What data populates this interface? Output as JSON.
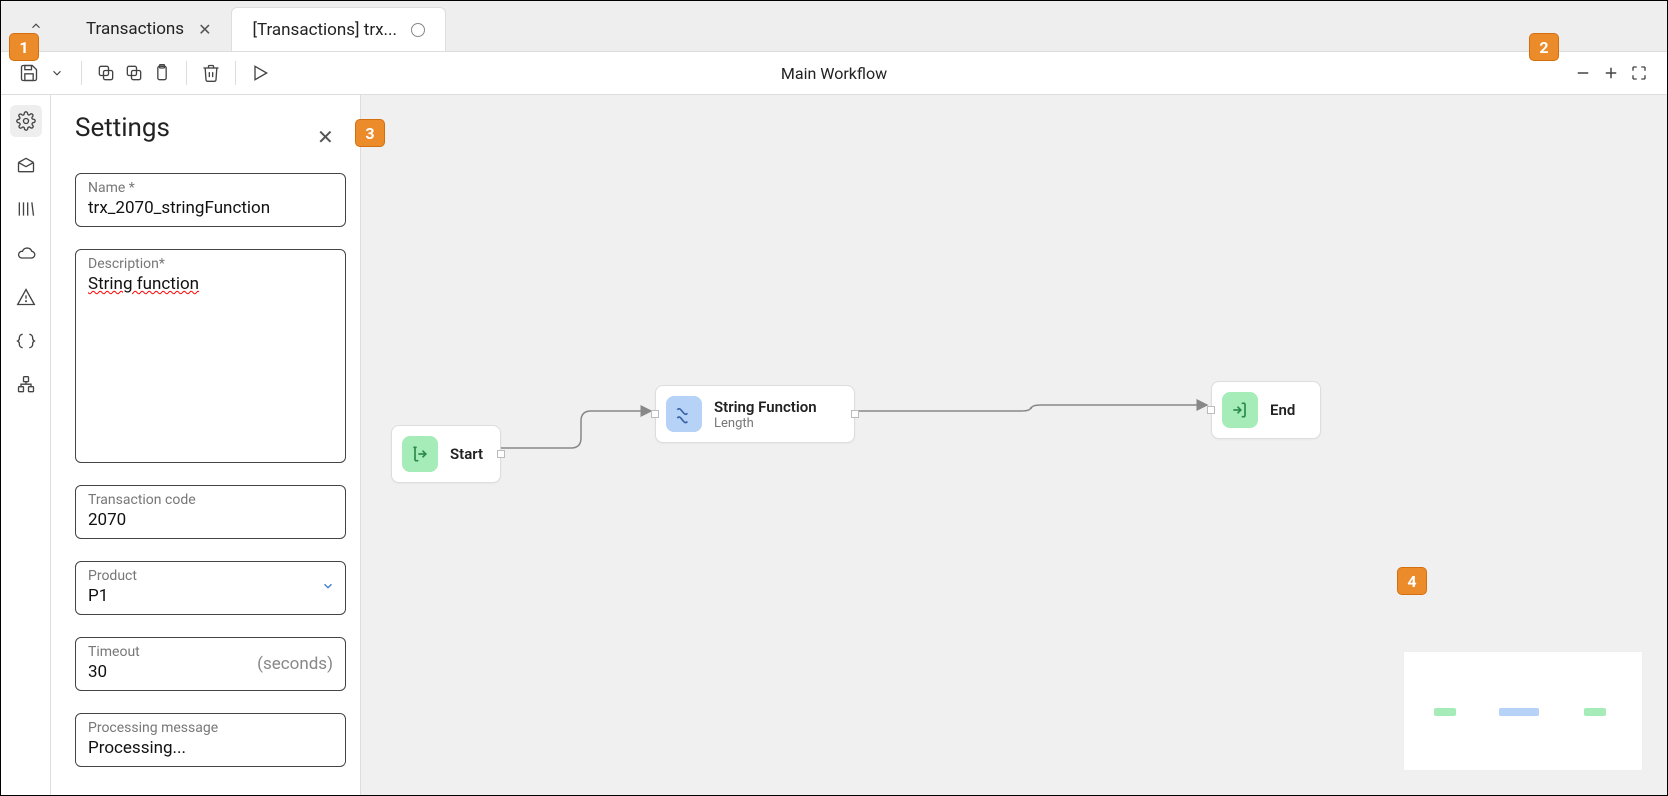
{
  "annotations": {
    "a1": "1",
    "a2": "2",
    "a3": "3",
    "a4": "4"
  },
  "tabs": [
    {
      "label": "Transactions"
    },
    {
      "label": "[Transactions] trx..."
    }
  ],
  "toolbar_title": "Main Workflow",
  "panel": {
    "title": "Settings",
    "name_label": "Name *",
    "name_value": "trx_2070_stringFunction",
    "desc_label": "Description*",
    "desc_value": "String function",
    "tcode_label": "Transaction code",
    "tcode_value": "2070",
    "product_label": "Product",
    "product_value": "P1",
    "timeout_label": "Timeout",
    "timeout_value": "30",
    "timeout_unit": "(seconds)",
    "procmsg_label": "Processing message",
    "procmsg_value": "Processing..."
  },
  "nodes": {
    "start": {
      "label": "Start"
    },
    "fn": {
      "title": "String Function",
      "sub": "Length"
    },
    "end": {
      "label": "End"
    }
  }
}
